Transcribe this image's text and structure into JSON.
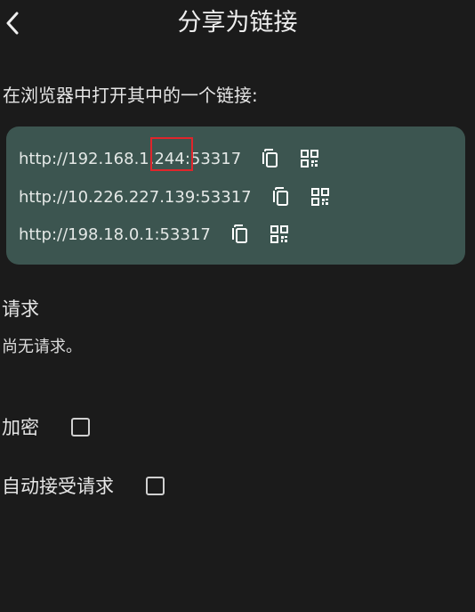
{
  "header": {
    "title": "分享为链接",
    "back_icon": "chevron-left-icon"
  },
  "instruction": "在浏览器中打开其中的一个链接:",
  "links": [
    {
      "url": "http://192.168.1.244:53317"
    },
    {
      "url": "http://10.226.227.139:53317"
    },
    {
      "url": "http://198.18.0.1:53317"
    }
  ],
  "link_icons": {
    "copy": "copy-icon",
    "qr": "qr-code-icon"
  },
  "requests": {
    "title": "请求",
    "empty_text": "尚无请求。"
  },
  "options": {
    "encryption_label": "加密",
    "encryption_checked": false,
    "auto_accept_label": "自动接受请求",
    "auto_accept_checked": false
  },
  "colors": {
    "background": "#1b1b1b",
    "card": "#3c5550",
    "highlight": "#e0252b"
  }
}
